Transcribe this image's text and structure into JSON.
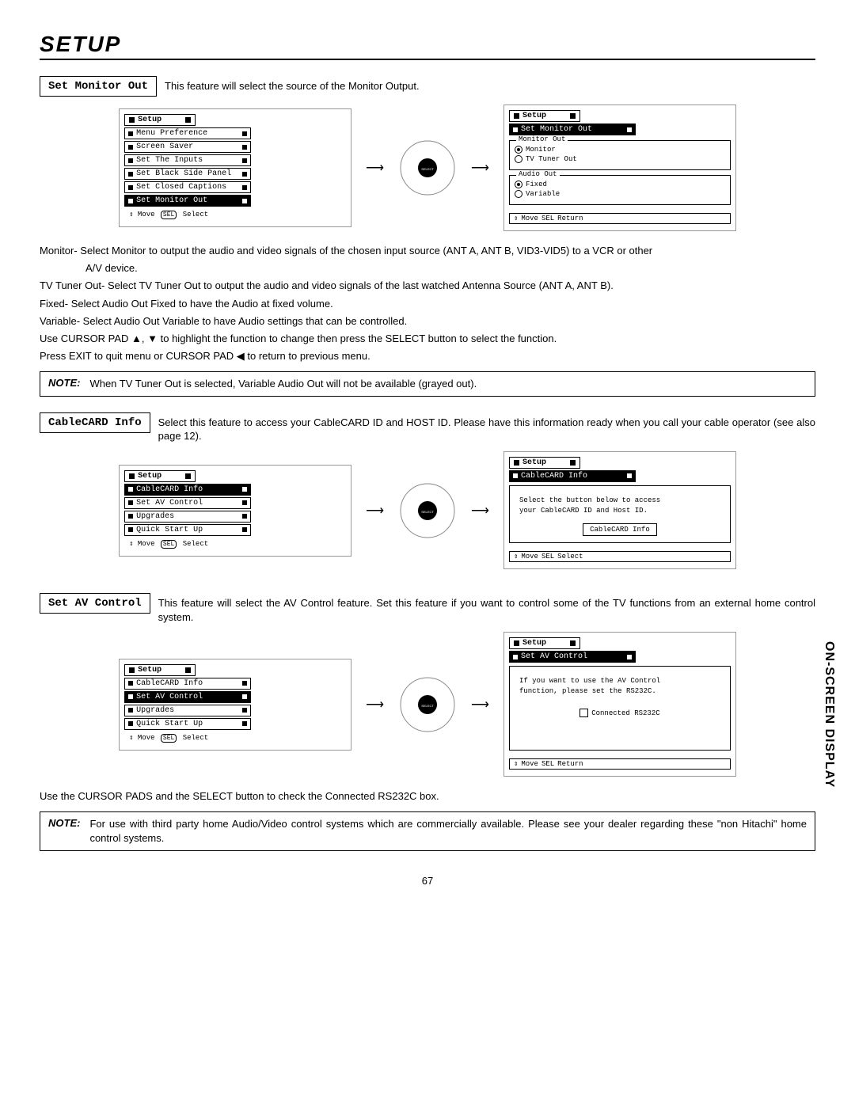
{
  "pageTitle": "Setup",
  "sideTab": "ON-SCREEN DISPLAY",
  "pageNumber": "67",
  "sec1": {
    "label": "Set Monitor Out",
    "desc": "This feature will select the source of the Monitor Output.",
    "leftMenu": {
      "tab": "Setup",
      "items": [
        "Menu Preference",
        "Screen Saver",
        "Set The Inputs",
        "Set Black Side Panel",
        "Set Closed Captions",
        "Set Monitor Out"
      ],
      "hintMove": "Move",
      "hintSel": "SEL",
      "hintAction": "Select"
    },
    "rightMenu": {
      "tab": "Setup",
      "header": "Set Monitor Out",
      "group1": {
        "legend": "Monitor Out",
        "opts": [
          "Monitor",
          "TV Tuner Out"
        ]
      },
      "group2": {
        "legend": "Audio Out",
        "opts": [
          "Fixed",
          "Variable"
        ]
      },
      "hintMove": "Move",
      "hintSel": "SEL",
      "hintAction": "Return"
    },
    "body": {
      "p1a": "Monitor- Select Monitor to output the audio and video signals of the chosen input source (ANT A, ANT B, VID3-VID5) to a VCR or other",
      "p1b": "A/V device.",
      "p2": "TV Tuner Out- Select TV Tuner Out to output the audio and video signals of the last watched Antenna Source (ANT A, ANT B).",
      "p3": "Fixed-  Select Audio Out Fixed to have the Audio at fixed volume.",
      "p4": "Variable- Select Audio Out Variable to have Audio settings that can be controlled.",
      "p5": "Use CURSOR PAD ▲, ▼ to highlight the function to change then press the SELECT button to select the function.",
      "p6": "Press EXIT to quit menu or CURSOR PAD ◀ to return to previous menu."
    },
    "note": {
      "label": "NOTE:",
      "text": "When TV Tuner Out is selected, Variable Audio Out will not be available (grayed out)."
    }
  },
  "sec2": {
    "label": "CableCARD Info",
    "desc": "Select this feature to access your CableCARD ID and HOST ID.  Please have this information ready when you call your cable operator (see also page 12).",
    "leftMenu": {
      "tab": "Setup",
      "items": [
        "CableCARD Info",
        "Set AV Control",
        "Upgrades",
        "Quick Start Up"
      ],
      "hintMove": "Move",
      "hintSel": "SEL",
      "hintAction": "Select"
    },
    "rightMenu": {
      "tab": "Setup",
      "header": "CableCARD Info",
      "body1": "Select the button below to access",
      "body2": "your CableCARD ID and Host ID.",
      "button": "CableCARD Info",
      "hintMove": "Move",
      "hintSel": "SEL",
      "hintAction": "Select"
    }
  },
  "sec3": {
    "label": "Set AV Control",
    "desc": "This feature will select the AV Control feature.  Set this feature if you want to control some of the TV functions from an external home control system.",
    "leftMenu": {
      "tab": "Setup",
      "items": [
        "CableCARD Info",
        "Set AV Control",
        "Upgrades",
        "Quick Start Up"
      ],
      "hintMove": "Move",
      "hintSel": "SEL",
      "hintAction": "Select"
    },
    "rightMenu": {
      "tab": "Setup",
      "header": "Set AV Control",
      "body1": "If you want to use the AV Control",
      "body2": "function, please set the RS232C.",
      "checkbox": "Connected RS232C",
      "hintMove": "Move",
      "hintSel": "SEL",
      "hintAction": "Return"
    },
    "after": "Use the CURSOR PADS and the SELECT button to check the Connected RS232C box.",
    "note": {
      "label": "NOTE:",
      "text": "For use with third party home Audio/Video control systems which are commercially available.  Please see your dealer regarding these \"non Hitachi\" home control systems."
    }
  },
  "remoteLabel": "SELECT"
}
